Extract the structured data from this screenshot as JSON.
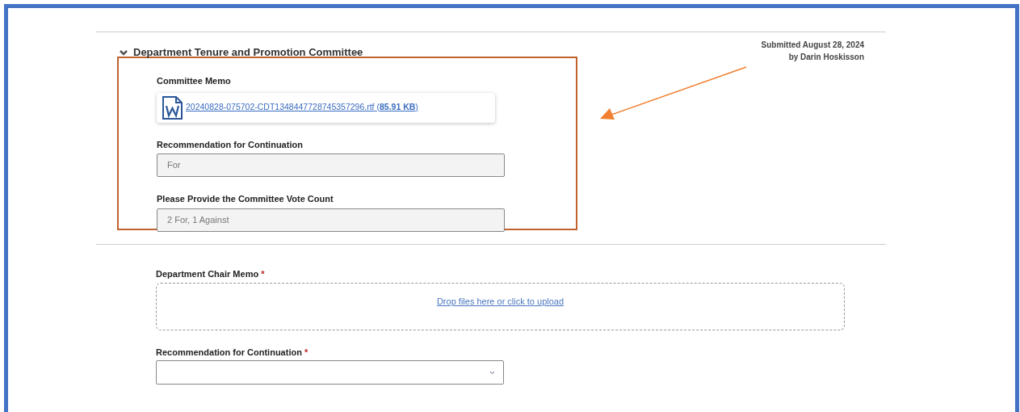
{
  "section": {
    "title": "Department Tenure and Promotion Committee",
    "expanded": true,
    "submitted": "Submitted August 28, 2024",
    "submitted_by": "by Darin Hoskisson",
    "memo": {
      "label": "Committee Memo",
      "file_name": "20240828-075702-CDT1348447728745357296.rtf",
      "file_size": "(**85.91 KB**)"
    },
    "fields": [
      {
        "label": "Recommendation for Continuation",
        "value": "For"
      },
      {
        "label": "Please Provide the Committee Vote Count",
        "value": "2 For, 1 Against"
      }
    ]
  },
  "form": {
    "upload": {
      "label": "Department Chair Memo",
      "required_mark": "*",
      "link": "Drop files here or click to upload"
    },
    "select": {
      "label": "Recommendation for Continuation",
      "required_mark": "*"
    }
  }
}
